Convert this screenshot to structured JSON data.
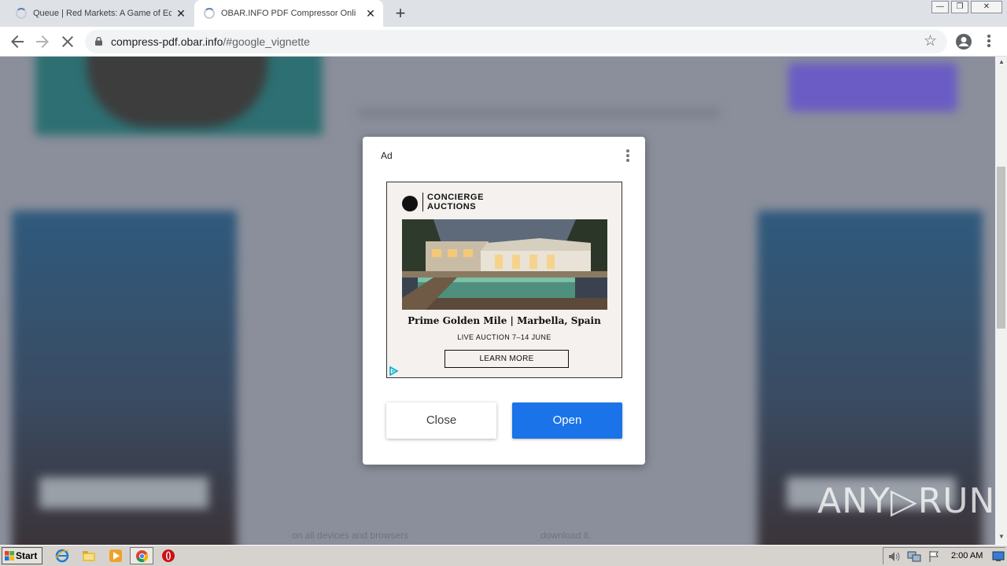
{
  "browser": {
    "tabs": [
      {
        "title": "Queue | Red Markets: A Game of Ec",
        "loading": true,
        "active": false
      },
      {
        "title": "OBAR.INFO PDF Compressor Online",
        "loading": true,
        "active": true
      }
    ],
    "new_tab_symbol": "+",
    "window_controls": {
      "minimize": "—",
      "restore": "❐",
      "close": "✕"
    },
    "url_host": "compress-pdf.obar.info",
    "url_path": "/#google_vignette",
    "icons": {
      "back": "back-arrow-icon",
      "forward": "forward-arrow-icon",
      "stop": "stop-icon",
      "lock": "lock-icon",
      "star": "star-icon",
      "profile": "profile-icon",
      "menu": "kebab-menu-icon"
    }
  },
  "page_background": {
    "bottom_text_left": "on all devices and browsers",
    "bottom_text_right": "download it."
  },
  "ad_dialog": {
    "label": "Ad",
    "brand_line1": "CONCIERGE",
    "brand_line2": "AUCTIONS",
    "headline": "Prime Golden Mile | Marbella, Spain",
    "subline": "LIVE AUCTION 7–14 JUNE",
    "cta": "LEARN MORE",
    "close_label": "Close",
    "open_label": "Open"
  },
  "watermark": "ANY▷RUN",
  "taskbar": {
    "start_label": "Start",
    "clock": "2:00 AM"
  },
  "colors": {
    "open_button": "#1a73e8",
    "overlay": "#8b8f9b",
    "tabstrip": "#dee1e6"
  }
}
